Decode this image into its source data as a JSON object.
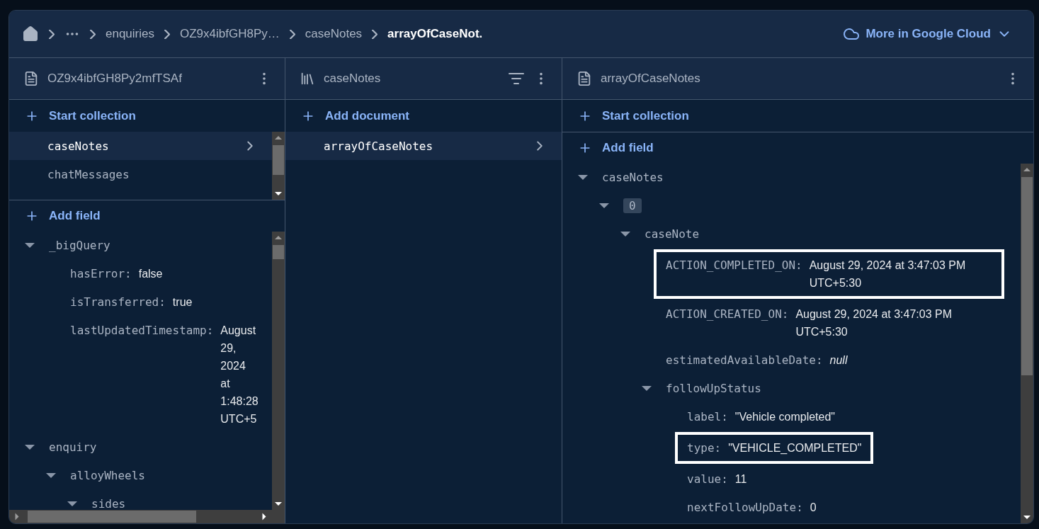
{
  "breadcrumbs": [
    {
      "label": "enquiries",
      "current": false
    },
    {
      "label": "OZ9x4ibfGH8Py…",
      "current": false
    },
    {
      "label": "caseNotes",
      "current": false
    },
    {
      "label": "arrayOfCaseNot.",
      "current": true
    }
  ],
  "cloud_link": "More in Google Cloud",
  "panels": [
    {
      "kind": "document",
      "title": "OZ9x4ibfGH8Py2mfTSAf",
      "filter": false,
      "sections": [
        {
          "kind": "action",
          "label": "Start collection"
        },
        {
          "kind": "list",
          "items": [
            {
              "label": "caseNotes",
              "selected": true
            },
            {
              "label": "chatMessages",
              "selected": false
            }
          ]
        },
        {
          "kind": "action",
          "label": "Add field"
        },
        {
          "kind": "tree",
          "nodes": [
            {
              "kind": "map",
              "key": "_bigQuery",
              "expanded": true,
              "children": [
                {
                  "kind": "field",
                  "key": "hasError:",
                  "value": "false",
                  "highlighted": false
                },
                {
                  "kind": "field",
                  "key": "isTransferred:",
                  "value": "true",
                  "highlighted": false
                },
                {
                  "kind": "field",
                  "key": "lastUpdatedTimestamp:",
                  "value": "August 29, 2024 at 1:48:28 UTC+5",
                  "highlighted": false
                }
              ]
            },
            {
              "kind": "map",
              "key": "enquiry",
              "expanded": true,
              "children": [
                {
                  "kind": "map",
                  "key": "alloyWheels",
                  "expanded": true,
                  "children": [
                    {
                      "kind": "map",
                      "key": "sides",
                      "expanded": true
                    }
                  ]
                }
              ]
            }
          ]
        }
      ]
    },
    {
      "kind": "collection",
      "title": "caseNotes",
      "filter": true,
      "sections": [
        {
          "kind": "action",
          "label": "Add document"
        },
        {
          "kind": "list",
          "items": [
            {
              "label": "arrayOfCaseNotes",
              "selected": true
            }
          ]
        }
      ]
    },
    {
      "kind": "document",
      "title": "arrayOfCaseNotes",
      "filter": false,
      "sections": [
        {
          "kind": "action",
          "label": "Start collection"
        },
        {
          "kind": "action",
          "label": "Add field"
        },
        {
          "kind": "tree",
          "nodes": [
            {
              "kind": "map",
              "key": "caseNotes",
              "expanded": true,
              "children": [
                {
                  "kind": "index",
                  "key": "0",
                  "expanded": true,
                  "children": [
                    {
                      "kind": "map",
                      "key": "caseNote",
                      "expanded": true,
                      "children": [
                        {
                          "kind": "field",
                          "key": "ACTION_COMPLETED_ON:",
                          "value": "August 29, 2024 at 3:47:03 PM UTC+5:30",
                          "highlighted": true
                        },
                        {
                          "kind": "field",
                          "key": "ACTION_CREATED_ON:",
                          "value": "August 29, 2024 at 3:47:03 PM UTC+5:30",
                          "highlighted": false
                        },
                        {
                          "kind": "null",
                          "key": "estimatedAvailableDate:",
                          "value": "null",
                          "highlighted": false
                        },
                        {
                          "kind": "map",
                          "key": "followUpStatus",
                          "expanded": true,
                          "children": [
                            {
                              "kind": "field",
                              "key": "label:",
                              "value": "\"Vehicle completed\"",
                              "highlighted": false
                            },
                            {
                              "kind": "field",
                              "key": "type:",
                              "value": "\"VEHICLE_COMPLETED\"",
                              "highlighted": true
                            },
                            {
                              "kind": "field",
                              "key": "value:",
                              "value": "11",
                              "highlighted": false
                            },
                            {
                              "kind": "field",
                              "key": "nextFollowUpDate:",
                              "value": "0",
                              "highlighted": false
                            }
                          ]
                        }
                      ]
                    }
                  ]
                }
              ]
            }
          ]
        }
      ]
    }
  ]
}
